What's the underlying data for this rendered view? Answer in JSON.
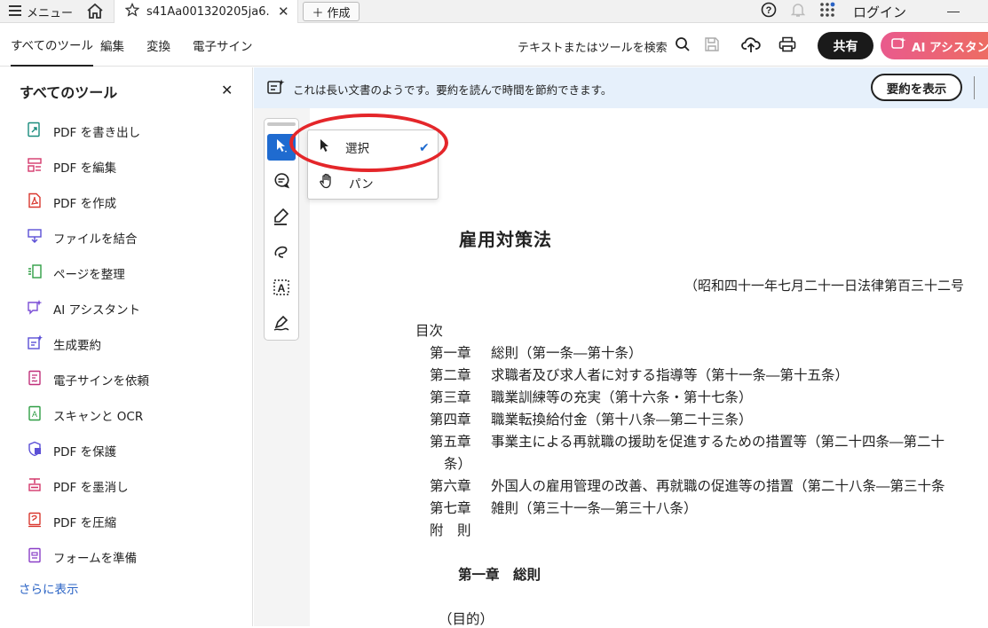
{
  "tabbar": {
    "menu_label": "メニュー",
    "doc_tab_title": "s41Aa001320205ja6....",
    "new_button": "作成",
    "login": "ログイン"
  },
  "toolbar": {
    "tabs": [
      "すべてのツール",
      "編集",
      "変換",
      "電子サイン"
    ],
    "search_label": "テキストまたはツールを検索",
    "share": "共有",
    "ai_assistant": "AI アシスタント"
  },
  "sidebar": {
    "title": "すべてのツール",
    "items": [
      {
        "label": "PDF を書き出し",
        "icon": "export-pdf-icon",
        "color": "#1a8c7d"
      },
      {
        "label": "PDF を編集",
        "icon": "edit-pdf-icon",
        "color": "#d4386c"
      },
      {
        "label": "PDF を作成",
        "icon": "create-pdf-icon",
        "color": "#d9382f"
      },
      {
        "label": "ファイルを結合",
        "icon": "combine-files-icon",
        "color": "#5b4fd6"
      },
      {
        "label": "ページを整理",
        "icon": "organize-pages-icon",
        "color": "#2f9e44"
      },
      {
        "label": "AI アシスタント",
        "icon": "ai-assistant-icon",
        "color": "#7b4fd6"
      },
      {
        "label": "生成要約",
        "icon": "summary-icon",
        "color": "#5b4fd6"
      },
      {
        "label": "電子サインを依頼",
        "icon": "request-signature-icon",
        "color": "#c0307a"
      },
      {
        "label": "スキャンと OCR",
        "icon": "scan-ocr-icon",
        "color": "#2f9e44"
      },
      {
        "label": "PDF を保護",
        "icon": "protect-pdf-icon",
        "color": "#5b4fd6"
      },
      {
        "label": "PDF を墨消し",
        "icon": "redact-pdf-icon",
        "color": "#d4386c"
      },
      {
        "label": "PDF を圧縮",
        "icon": "compress-pdf-icon",
        "color": "#d9382f"
      },
      {
        "label": "フォームを準備",
        "icon": "prepare-form-icon",
        "color": "#8a3fc7"
      }
    ],
    "more": "さらに表示"
  },
  "banner": {
    "message": "これは長い文書のようです。要約を読んで時間を節約できます。",
    "button": "要約を表示"
  },
  "tool_menu": {
    "select": "選択",
    "pan": "パン"
  },
  "document": {
    "title": "雇用対策法",
    "meta": "（昭和四十一年七月二十一日法律第百三十二号",
    "toc_heading": "目次",
    "toc": [
      {
        "chapter": "第一章",
        "text": "総則（第一条―第十条）"
      },
      {
        "chapter": "第二章",
        "text": "求職者及び求人者に対する指導等（第十一条―第十五条）"
      },
      {
        "chapter": "第三章",
        "text": "職業訓練等の充実（第十六条・第十七条）"
      },
      {
        "chapter": "第四章",
        "text": "職業転換給付金（第十八条―第二十三条）"
      },
      {
        "chapter": "第五章",
        "text": "事業主による再就職の援助を促進するための措置等（第二十四条―第二十"
      },
      {
        "chapter": "",
        "text": "条）"
      },
      {
        "chapter": "第六章",
        "text": "外国人の雇用管理の改善、再就職の促進等の措置（第二十八条―第三十条"
      },
      {
        "chapter": "第七章",
        "text": "雑則（第三十一条―第三十八条）"
      },
      {
        "chapter": "附　則",
        "text": ""
      }
    ],
    "chapter1_heading": "第一章　総則",
    "article_heading": "（目的）"
  },
  "colors": {
    "accent": "#1f6bd0",
    "annotation": "#e4262a",
    "banner_bg": "#e6f0fb"
  }
}
